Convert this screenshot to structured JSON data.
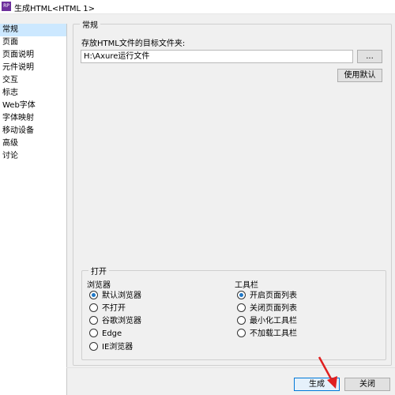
{
  "window": {
    "title": "生成HTML<HTML 1>",
    "icon": "axure-app-icon"
  },
  "sidebar": {
    "items": [
      {
        "label": "常规",
        "active": true
      },
      {
        "label": "页面",
        "active": false
      },
      {
        "label": "页面说明",
        "active": false
      },
      {
        "label": "元件说明",
        "active": false
      },
      {
        "label": "交互",
        "active": false
      },
      {
        "label": "标志",
        "active": false
      },
      {
        "label": "Web字体",
        "active": false
      },
      {
        "label": "字体映射",
        "active": false
      },
      {
        "label": "移动设备",
        "active": false
      },
      {
        "label": "高级",
        "active": false
      },
      {
        "label": "讨论",
        "active": false
      }
    ]
  },
  "general": {
    "group_title": "常规",
    "folder_label": "存放HTML文件的目标文件夹:",
    "folder_value": "H:\\Axure运行文件",
    "browse_label": "...",
    "default_label": "使用默认"
  },
  "open": {
    "group_title": "打开",
    "browser_heading": "浏览器",
    "browser_options": [
      {
        "label": "默认浏览器",
        "selected": true
      },
      {
        "label": "不打开",
        "selected": false
      },
      {
        "label": "谷歌浏览器",
        "selected": false
      },
      {
        "label": "Edge",
        "selected": false
      },
      {
        "label": "IE浏览器",
        "selected": false
      }
    ],
    "toolbar_heading": "工具栏",
    "toolbar_options": [
      {
        "label": "开启页面列表",
        "selected": true
      },
      {
        "label": "关闭页面列表",
        "selected": false
      },
      {
        "label": "最小化工具栏",
        "selected": false
      },
      {
        "label": "不加载工具栏",
        "selected": false
      }
    ]
  },
  "footer": {
    "generate_label": "生成",
    "close_label": "关闭"
  },
  "colors": {
    "accent": "#1e78c8",
    "selection": "#cce8ff",
    "annotation_arrow": "#e02020"
  }
}
